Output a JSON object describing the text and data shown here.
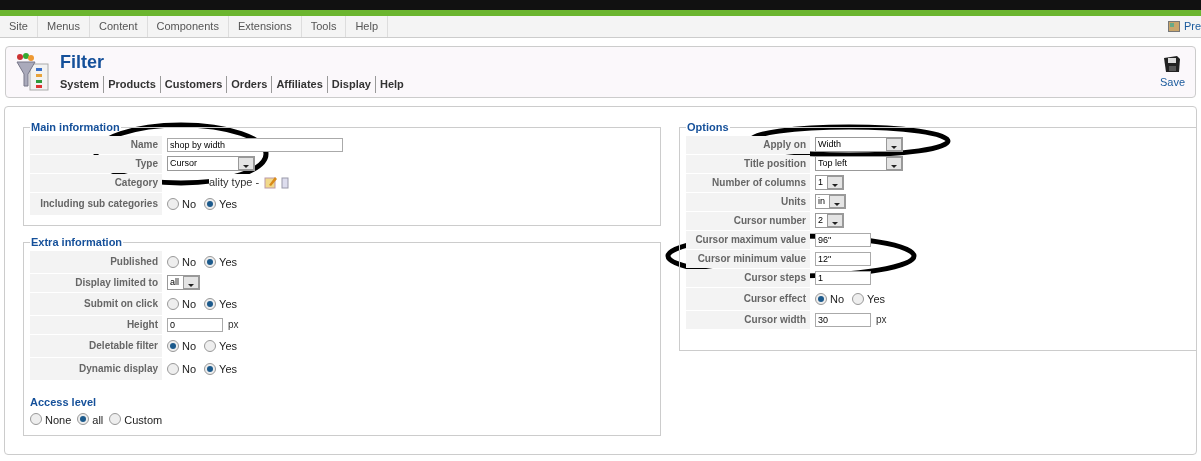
{
  "menu": [
    "Site",
    "Menus",
    "Content",
    "Components",
    "Extensions",
    "Tools",
    "Help"
  ],
  "preview_link": "Pre",
  "header": {
    "title": "Filter",
    "submenu": [
      "System",
      "Products",
      "Customers",
      "Orders",
      "Affiliates",
      "Display",
      "Help"
    ],
    "save": "Save"
  },
  "main_information": {
    "legend": "Main information",
    "rows": [
      {
        "kind": "text",
        "label": "Name",
        "value": "shop by width"
      },
      {
        "kind": "select",
        "label": "Type",
        "value": "Cursor"
      },
      {
        "kind": "category",
        "label": "Category",
        "value": "ality type -"
      },
      {
        "kind": "radio",
        "label": "Including sub categories",
        "options": [
          {
            "label": "No",
            "selected": false
          },
          {
            "label": "Yes",
            "selected": true
          }
        ]
      }
    ]
  },
  "extra_information": {
    "legend": "Extra information",
    "rows": [
      {
        "kind": "radio",
        "label": "Published",
        "options": [
          {
            "label": "No",
            "selected": false
          },
          {
            "label": "Yes",
            "selected": true
          }
        ]
      },
      {
        "kind": "select",
        "label": "Display limited to",
        "value": "all"
      },
      {
        "kind": "radio",
        "label": "Submit on click",
        "options": [
          {
            "label": "No",
            "selected": false
          },
          {
            "label": "Yes",
            "selected": true
          }
        ]
      },
      {
        "kind": "text",
        "label": "Height",
        "value": "0",
        "unit": "px"
      },
      {
        "kind": "radio",
        "label": "Deletable filter",
        "options": [
          {
            "label": "No",
            "selected": true
          },
          {
            "label": "Yes",
            "selected": false
          }
        ]
      },
      {
        "kind": "radio",
        "label": "Dynamic display",
        "options": [
          {
            "label": "No",
            "selected": false
          },
          {
            "label": "Yes",
            "selected": true
          }
        ]
      }
    ],
    "access_level": {
      "heading": "Access level",
      "options": [
        {
          "label": "None",
          "selected": false
        },
        {
          "label": "all",
          "selected": true
        },
        {
          "label": "Custom",
          "selected": false
        }
      ]
    }
  },
  "options": {
    "legend": "Options",
    "rows": [
      {
        "kind": "select",
        "label": "Apply on",
        "value": "Width"
      },
      {
        "kind": "select",
        "label": "Title position",
        "value": "Top left"
      },
      {
        "kind": "select",
        "label": "Number of columns",
        "value": "1"
      },
      {
        "kind": "select",
        "label": "Units",
        "value": "in"
      },
      {
        "kind": "select",
        "label": "Cursor number",
        "value": "2"
      },
      {
        "kind": "text",
        "label": "Cursor maximum value",
        "value": "96\""
      },
      {
        "kind": "text",
        "label": "Cursor minimum value",
        "value": "12\""
      },
      {
        "kind": "text",
        "label": "Cursor steps",
        "value": "1"
      },
      {
        "kind": "radio",
        "label": "Cursor effect",
        "options": [
          {
            "label": "No",
            "selected": true
          },
          {
            "label": "Yes",
            "selected": false
          }
        ]
      },
      {
        "kind": "text",
        "label": "Cursor width",
        "value": "30",
        "unit": "px"
      }
    ]
  }
}
